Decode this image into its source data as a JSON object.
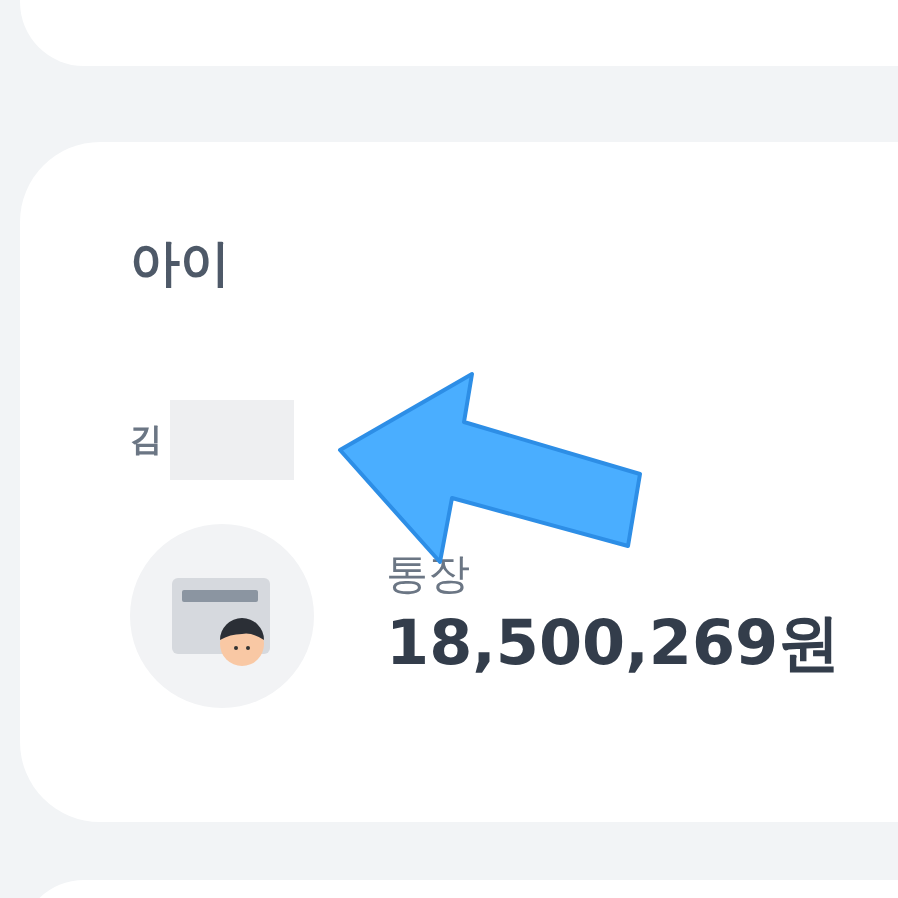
{
  "section": {
    "title": "아이",
    "owner_name": "김"
  },
  "account": {
    "label": "통장",
    "balance": "18,500,269원"
  }
}
